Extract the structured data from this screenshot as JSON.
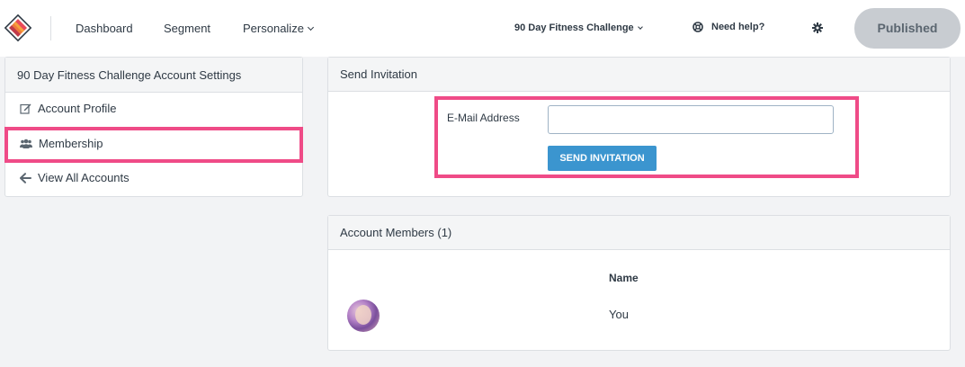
{
  "nav": {
    "dashboard": "Dashboard",
    "segment": "Segment",
    "personalize": "Personalize",
    "account_name": "90 Day Fitness Challenge",
    "help": "Need help?",
    "published": "Published"
  },
  "sidebar": {
    "title": "90 Day Fitness Challenge Account Settings",
    "items": [
      {
        "label": "Account Profile",
        "icon": "edit-icon"
      },
      {
        "label": "Membership",
        "icon": "users-icon"
      },
      {
        "label": "View All Accounts",
        "icon": "arrow-left-icon"
      }
    ]
  },
  "invite": {
    "title": "Send Invitation",
    "email_label": "E-Mail Address",
    "email_value": "",
    "send_label": "SEND INVITATION"
  },
  "members": {
    "title": "Account Members (1)",
    "column_name": "Name",
    "rows": [
      {
        "name": "You"
      }
    ]
  },
  "colors": {
    "accent": "#3b95cf",
    "highlight": "#ef4b87",
    "published_bg": "#c8ccd1"
  }
}
